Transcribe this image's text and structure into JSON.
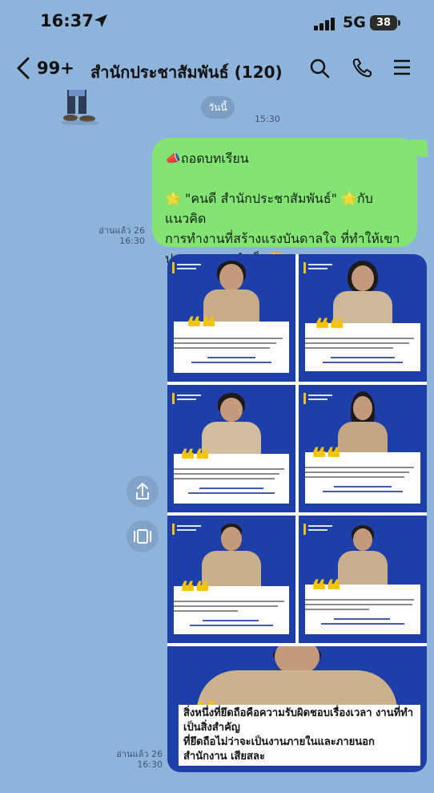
{
  "status_bar": {
    "time": "16:37",
    "network": "5G",
    "battery": "38"
  },
  "header": {
    "unread_count": "99+",
    "title": "สำนักประชาสัมพันธ์ (120)"
  },
  "chat": {
    "date_chip": "วันนี้",
    "sticker_time": "15:30",
    "message": {
      "line1": "📣ถอดบทเรียน",
      "line2": "🌟 \"คนดี สำนักประชาสัมพันธ์\" 🌟กับแนวคิด",
      "line3": "การทำงานที่สร้างแรงบันดาลใจ ที่ทำให้เขา",
      "line4": "ประสบความสำเร็จ🏆",
      "read_status": "อ่านแล้ว 26",
      "time": "16:30"
    },
    "album": {
      "read_status": "อ่านแล้ว 26",
      "time": "16:30",
      "big_caption_line1": "สิ่งหนึ่งที่ยึดถือคือความรับผิดชอบเรื่องเวลา งานที่ทำ เป็นสิ่งสำคัญ",
      "big_caption_line2": "ที่ยึดถือไม่ว่าจะเป็นงานภายในและภายนอกสำนักงาน เสียสละ"
    }
  },
  "colors": {
    "background": "#8eb4dc",
    "bubble": "#83e474",
    "card_blue": "#1f3fa8",
    "quote_yellow": "#f5c400"
  }
}
